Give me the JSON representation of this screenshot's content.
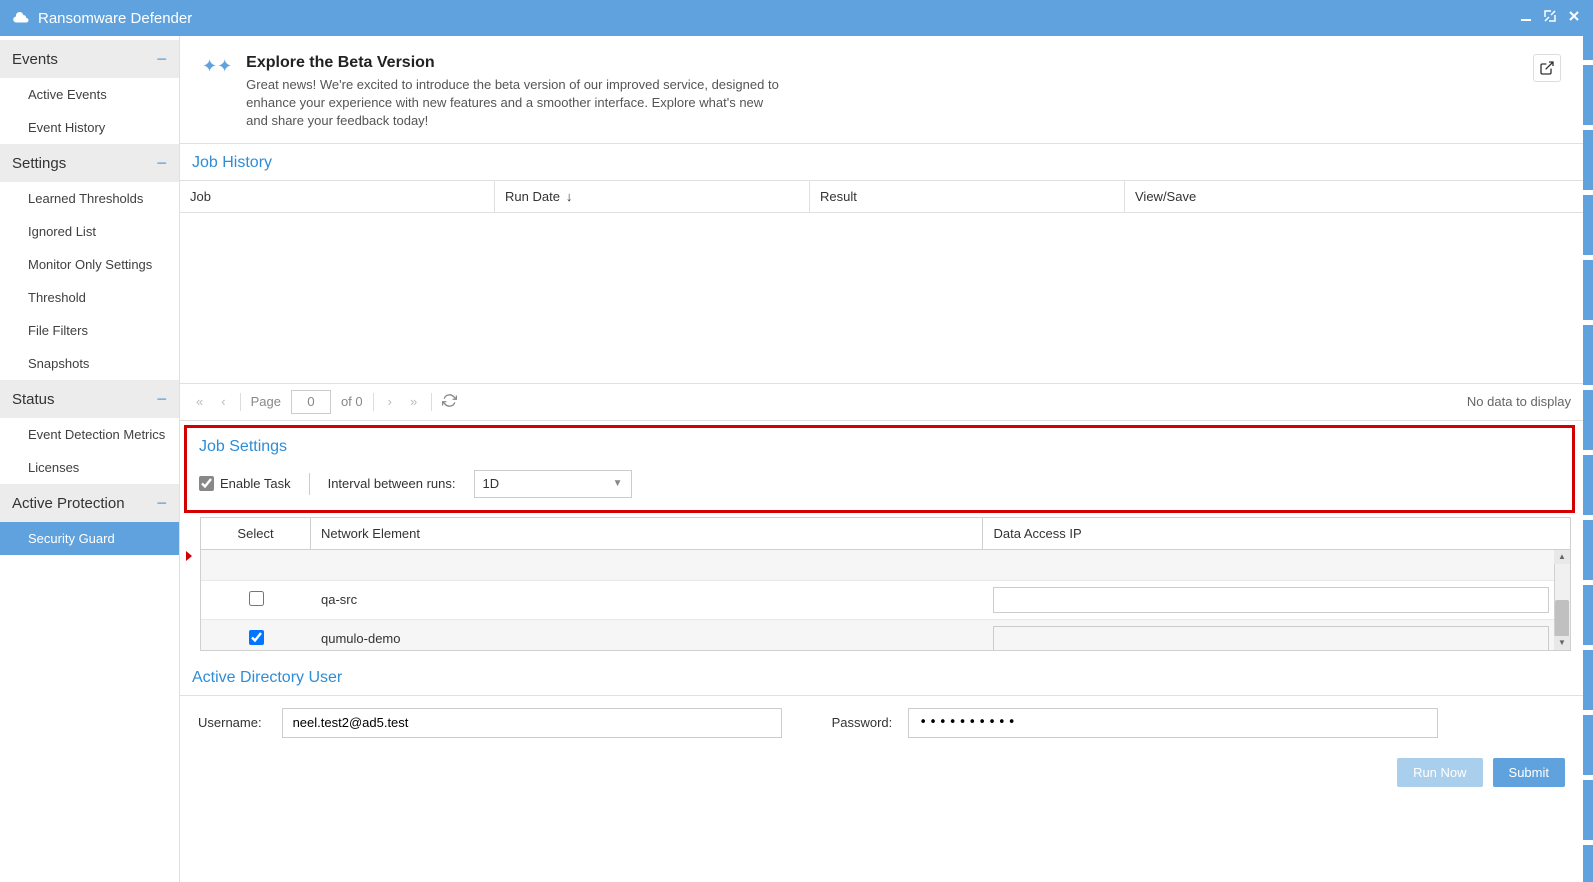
{
  "titlebar": {
    "title": "Ransomware Defender"
  },
  "sidebar": {
    "groups": [
      {
        "label": "Events",
        "items": [
          "Active Events",
          "Event History"
        ]
      },
      {
        "label": "Settings",
        "items": [
          "Learned Thresholds",
          "Ignored List",
          "Monitor Only Settings",
          "Threshold",
          "File Filters",
          "Snapshots"
        ]
      },
      {
        "label": "Status",
        "items": [
          "Event Detection Metrics",
          "Licenses"
        ]
      },
      {
        "label": "Active Protection",
        "items": [
          "Security Guard"
        ]
      }
    ],
    "activeItem": "Security Guard"
  },
  "beta": {
    "title": "Explore the Beta Version",
    "text": "Great news! We're excited to introduce the beta version of our improved service, designed to enhance your experience with new features and a smoother interface. Explore what's new and share your feedback today!"
  },
  "jobHistory": {
    "title": "Job History",
    "columns": {
      "job": "Job",
      "runDate": "Run Date",
      "result": "Result",
      "viewSave": "View/Save"
    },
    "paging": {
      "pageLabel": "Page",
      "pageValue": "0",
      "ofLabel": "of 0",
      "noData": "No data to display"
    }
  },
  "jobSettings": {
    "title": "Job Settings",
    "enableTask": {
      "label": "Enable Task",
      "checked": true
    },
    "intervalLabel": "Interval between runs:",
    "intervalValue": "1D",
    "table": {
      "columns": {
        "select": "Select",
        "name": "Network Element",
        "ip": "Data Access IP"
      },
      "rows": [
        {
          "selected": false,
          "name": "",
          "ip": ""
        },
        {
          "selected": false,
          "name": "qa-src",
          "ip": ""
        },
        {
          "selected": true,
          "name": "qumulo-demo",
          "ip": ""
        }
      ]
    }
  },
  "adUser": {
    "title": "Active Directory User",
    "usernameLabel": "Username:",
    "usernameValue": "neel.test2@ad5.test",
    "passwordLabel": "Password:",
    "passwordValue": "••••••••••"
  },
  "buttons": {
    "runNow": "Run Now",
    "submit": "Submit"
  }
}
